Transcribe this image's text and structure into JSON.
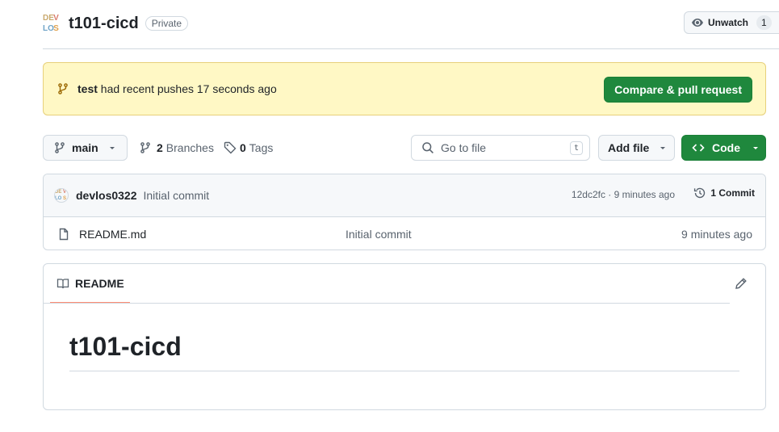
{
  "repo": {
    "avatar_letters": [
      "DE",
      "V",
      "LO",
      "S"
    ],
    "name": "t101-cicd",
    "visibility": "Private"
  },
  "watch": {
    "label": "Unwatch",
    "count": "1"
  },
  "push_banner": {
    "branch": "test",
    "message": "had recent pushes 17 seconds ago",
    "button_label": "Compare & pull request"
  },
  "toolbar": {
    "branch": "main",
    "branches_count": "2",
    "branches_label": "Branches",
    "tags_count": "0",
    "tags_label": "Tags",
    "goto_placeholder": "Go to file",
    "goto_shortcut": "t",
    "add_file_label": "Add file",
    "code_label": "Code"
  },
  "latest_commit": {
    "author": "devlos0322",
    "message": "Initial commit",
    "meta": "12dc2fc · 9 minutes ago",
    "count_label": "1 Commit"
  },
  "files": [
    {
      "name": "README.md",
      "commit": "Initial commit",
      "age": "9 minutes ago",
      "icon": "file-icon"
    }
  ],
  "readme": {
    "tab_label": "README",
    "heading": "t101-cicd"
  },
  "colors": {
    "primary_green": "#1f883d",
    "banner_bg": "#fff8c5",
    "tab_underline": "#fd8c73",
    "border": "#d1d9e0"
  }
}
